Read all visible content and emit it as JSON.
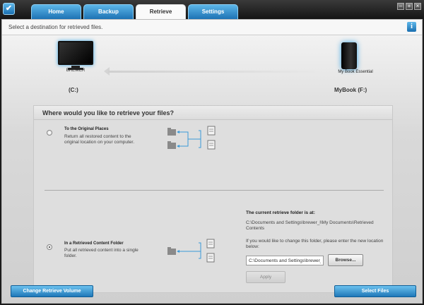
{
  "window": {
    "logo_glyph": "✔",
    "controls": {
      "minimize": "–",
      "maximize": "+",
      "close": "×"
    }
  },
  "tabs": [
    {
      "label": "Home",
      "active": false
    },
    {
      "label": "Backup",
      "active": false
    },
    {
      "label": "Retrieve",
      "active": true
    },
    {
      "label": "Settings",
      "active": false
    }
  ],
  "header": {
    "prompt": "Select a destination for retrieved files.",
    "info_label": "i"
  },
  "devices": {
    "computer_name": "BREWER",
    "computer_volume": "(C:)",
    "drive_name": "My Book Essential",
    "drive_volume": "MyBook (F:)"
  },
  "retrieve_panel": {
    "title": "Where would you like to retrieve your files?",
    "option_original": {
      "title": "To the Original Places",
      "description": "Return all restored content to the original location on your computer.",
      "selected": false
    },
    "option_folder": {
      "title": "In a Retrieved Content Folder",
      "description": "Put all retrieved content into a single folder.",
      "selected": true
    },
    "current_folder_title": "The current retrieve folder is at:",
    "current_folder_path": "C:\\Documents and Settings\\brewer_l\\My Documents\\Retrieved Contents",
    "change_hint": "If you would like to change this folder, please enter the new location below:",
    "path_input_value": "C:\\Documents and Settings\\brewer_l",
    "browse_label": "Browse...",
    "apply_label": "Apply"
  },
  "footer": {
    "change_volume_label": "Change Retrieve Volume",
    "select_files_label": "Select Files"
  },
  "colors": {
    "accent_blue": "#2a88c8",
    "topbar": "#1b1b1b",
    "panel_bg": "#dedede"
  }
}
